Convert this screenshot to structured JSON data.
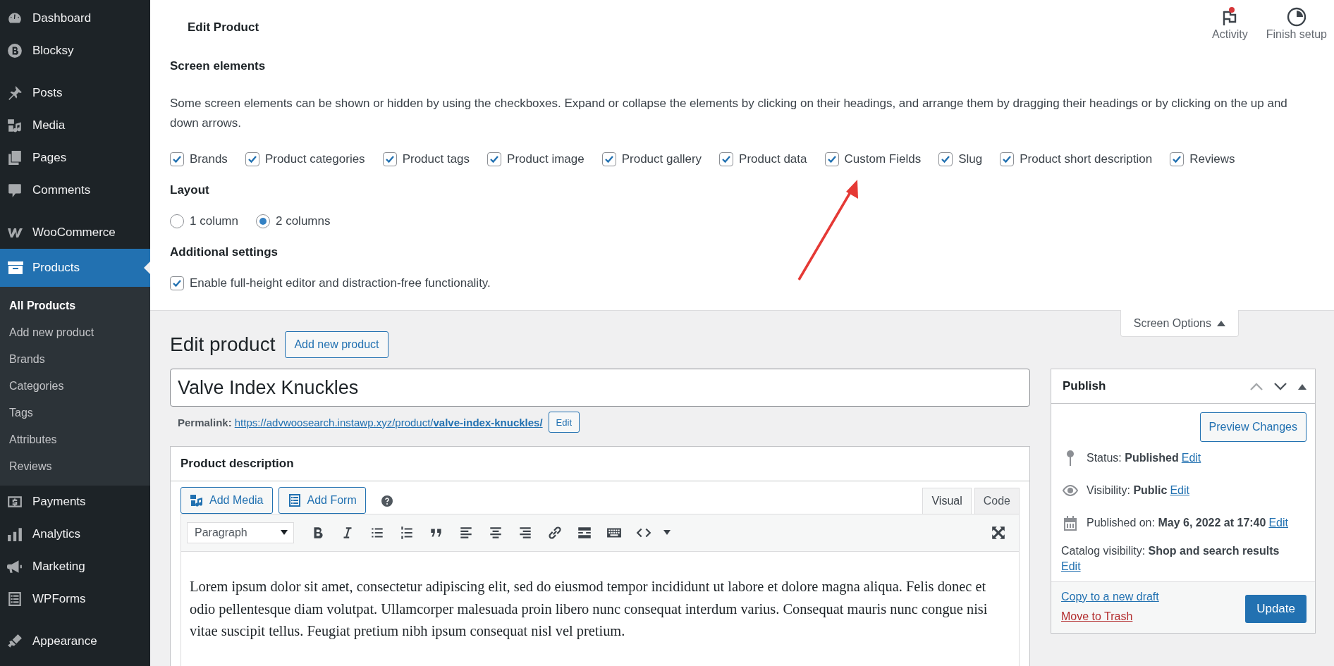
{
  "sidebar": {
    "menu_groups": [
      [
        {
          "label": "Dashboard",
          "selected": false
        },
        {
          "label": "Blocksy",
          "selected": false
        }
      ],
      [
        {
          "label": "Posts",
          "selected": false
        },
        {
          "label": "Media",
          "selected": false
        },
        {
          "label": "Pages",
          "selected": false
        },
        {
          "label": "Comments",
          "selected": false
        }
      ],
      [
        {
          "label": "WooCommerce",
          "selected": false
        },
        {
          "label": "Products",
          "selected": true,
          "children": [
            {
              "label": "All Products",
              "selected": true
            },
            {
              "label": "Add new product",
              "selected": false
            },
            {
              "label": "Brands",
              "selected": false
            },
            {
              "label": "Categories",
              "selected": false
            },
            {
              "label": "Tags",
              "selected": false
            },
            {
              "label": "Attributes",
              "selected": false
            },
            {
              "label": "Reviews",
              "selected": false
            }
          ]
        },
        {
          "label": "Payments",
          "selected": false
        },
        {
          "label": "Analytics",
          "selected": false
        },
        {
          "label": "Marketing",
          "selected": false
        },
        {
          "label": "WPForms",
          "selected": false
        }
      ],
      [
        {
          "label": "Appearance",
          "selected": false
        }
      ]
    ]
  },
  "header": {
    "title": "Edit Product",
    "actions": [
      {
        "label": "Activity",
        "notification": true
      },
      {
        "label": "Finish setup",
        "notification": false
      }
    ]
  },
  "screen_options": {
    "heading": "Screen elements",
    "description": "Some screen elements can be shown or hidden by using the checkboxes. Expand or collapse the elements by clicking on their headings, and arrange them by dragging their headings or by clicking on the up and down arrows.",
    "elements": [
      {
        "label": "Brands",
        "checked": true
      },
      {
        "label": "Product categories",
        "checked": true
      },
      {
        "label": "Product tags",
        "checked": true
      },
      {
        "label": "Product image",
        "checked": true
      },
      {
        "label": "Product gallery",
        "checked": true
      },
      {
        "label": "Product data",
        "checked": true
      },
      {
        "label": "Custom Fields",
        "checked": true
      },
      {
        "label": "Slug",
        "checked": true
      },
      {
        "label": "Product short description",
        "checked": true
      },
      {
        "label": "Reviews",
        "checked": true
      }
    ],
    "layout_heading": "Layout",
    "layout_options": [
      {
        "label": "1 column",
        "selected": false
      },
      {
        "label": "2 columns",
        "selected": true
      }
    ],
    "additional_heading": "Additional settings",
    "additional": [
      {
        "label": "Enable full-height editor and distraction-free functionality.",
        "checked": true
      }
    ],
    "toggle_label": "Screen Options",
    "expanded": true
  },
  "editor": {
    "heading": "Edit product",
    "add_new_button": "Add new product",
    "title_value": "Valve Index Knuckles",
    "permalink": {
      "label": "Permalink:",
      "url_base": "https://advwoosearch.instawp.xyz/product/",
      "slug": "valve-index-knuckles/",
      "edit_button": "Edit"
    },
    "description_box": {
      "title": "Product description",
      "media_buttons": [
        "Add Media",
        "Add Form"
      ],
      "tabs": [
        {
          "label": "Visual",
          "selected": true
        },
        {
          "label": "Code",
          "selected": false
        }
      ],
      "format": "Paragraph",
      "content": "Lorem ipsum dolor sit amet, consectetur adipiscing elit, sed do eiusmod tempor incididunt ut labore et dolore magna aliqua. Felis donec et odio pellentesque diam volutpat. Ullamcorper malesuada proin libero nunc consequat interdum varius. Consequat mauris nunc congue nisi vitae suscipit tellus. Feugiat pretium nibh ipsum consequat nisl vel pretium."
    }
  },
  "publish": {
    "title": "Publish",
    "preview_button": "Preview Changes",
    "rows": [
      {
        "label": "Status:",
        "value": "Published",
        "link": "Edit"
      },
      {
        "label": "Visibility:",
        "value": "Public",
        "link": "Edit"
      },
      {
        "label": "Published on:",
        "value": "May 6, 2022 at 17:40",
        "link": "Edit"
      },
      {
        "label": "Catalog visibility:",
        "value": "Shop and search results",
        "link": "Edit"
      }
    ],
    "copy_link": "Copy to a new draft",
    "trash_link": "Move to Trash",
    "update_button": "Update"
  }
}
